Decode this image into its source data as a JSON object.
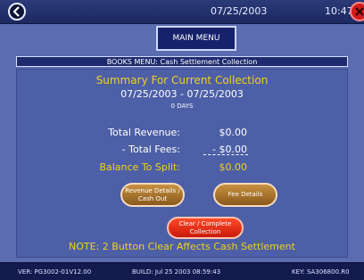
{
  "header": {
    "date": "07/25/2003",
    "time": "10:47"
  },
  "nav": {
    "main_menu_label": "MAIN MENU"
  },
  "section": {
    "title": "BOOKS MENU: Cash Settlement Collection"
  },
  "summary": {
    "title": "Summary For Current Collection",
    "date_range": "07/25/2003 - 07/25/2003",
    "days": "0 DAYS"
  },
  "totals": {
    "revenue_label": "Total Revenue:",
    "revenue_value": "$0.00",
    "fees_label": "- Total Fees:",
    "fees_value": "- $0.00",
    "balance_label": "Balance To Split:",
    "balance_value": "$0.00"
  },
  "buttons": {
    "revenue_details_line1": "Revenue Details /",
    "revenue_details_line2": "Cash Out",
    "fee_details": "Fee Details",
    "clear_complete": "Clear / Complete Collection"
  },
  "note": "NOTE: 2 Button Clear Affects Cash Settlement",
  "footer": {
    "version": "VER: PG3002-01V12.00",
    "build": "BUILD: Jul 25 2003 08:59:43",
    "key": "KEY: SA306800.R0"
  },
  "colors": {
    "accent_yellow": "#f0d21c",
    "panel_blue": "#4d5fa6",
    "close_red": "#d21a1a"
  }
}
